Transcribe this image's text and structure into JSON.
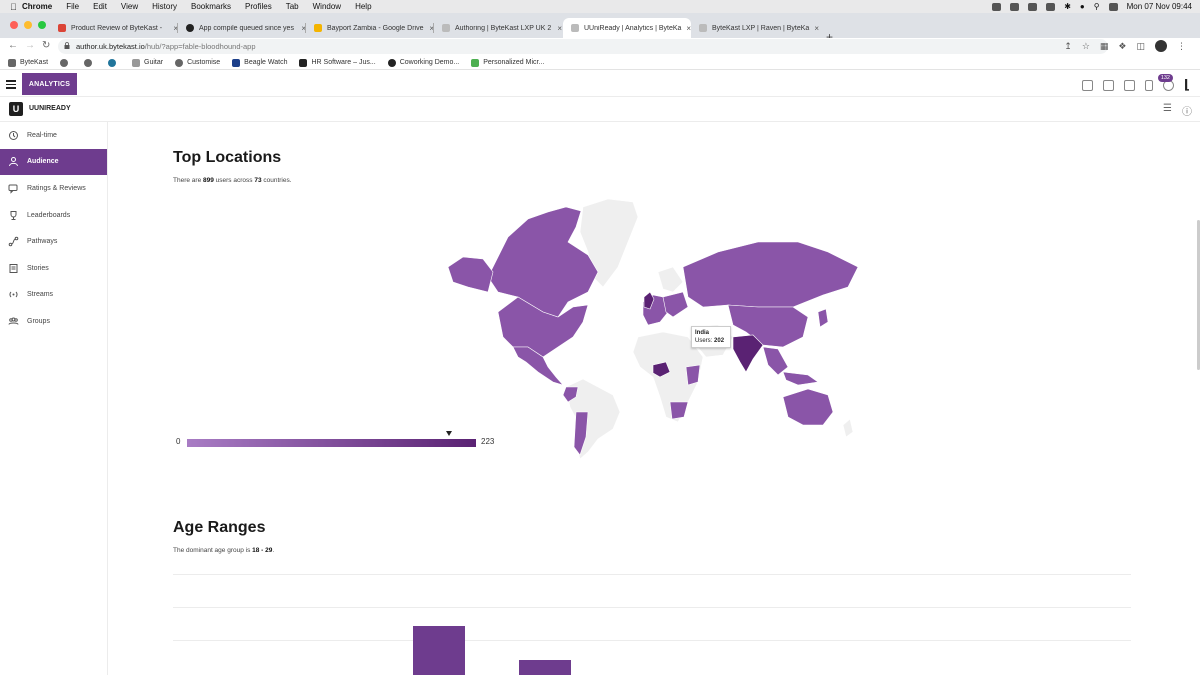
{
  "menubar": {
    "app": "Chrome",
    "items": [
      "File",
      "Edit",
      "View",
      "History",
      "Bookmarks",
      "Profiles",
      "Tab",
      "Window",
      "Help"
    ],
    "clock": "Mon 07 Nov  09:44"
  },
  "tabs": [
    {
      "label": "Product Review of ByteKast - ",
      "color": "#db4437"
    },
    {
      "label": "App compile queued since yes",
      "color": "#222222"
    },
    {
      "label": "Bayport Zambia - Google Drive",
      "color": "#f4b400"
    },
    {
      "label": "Authoring | ByteKast LXP UK 2",
      "color": "#999999"
    },
    {
      "label": "UUniReady | Analytics | ByteKa",
      "color": "#999999"
    },
    {
      "label": "ByteKast LXP | Raven | ByteKa",
      "color": "#999999"
    }
  ],
  "address": {
    "host": "author.uk.bytekast.io",
    "path": "/hub/?app=fable-bloodhound-app"
  },
  "bookmarks": [
    "ByteKast",
    "",
    "",
    "",
    "Guitar",
    "Customise",
    "Beagle Watch",
    "HR Software – Jus...",
    "Coworking Demo...",
    "Personalized Micr..."
  ],
  "header": {
    "section": "ANALYTICS",
    "badge": "132"
  },
  "org": {
    "name": "UUNIREADY",
    "logo": "U"
  },
  "sidebar": {
    "items": [
      {
        "label": "Real-time",
        "icon": "realtime-icon"
      },
      {
        "label": "Audience",
        "icon": "user-icon"
      },
      {
        "label": "Ratings & Reviews",
        "icon": "chat-icon"
      },
      {
        "label": "Leaderboards",
        "icon": "trophy-icon"
      },
      {
        "label": "Pathways",
        "icon": "pathway-icon"
      },
      {
        "label": "Stories",
        "icon": "book-icon"
      },
      {
        "label": "Streams",
        "icon": "broadcast-icon"
      },
      {
        "label": "Groups",
        "icon": "groups-icon"
      }
    ],
    "active": "Audience"
  },
  "locations": {
    "title": "Top Locations",
    "desc_pre": "There are ",
    "users": "899",
    "desc_mid": " users across ",
    "countries": "73",
    "desc_post": " countries.",
    "legend_min": "0",
    "legend_max": "223",
    "legend_marker": 202,
    "tooltip_country": "India",
    "tooltip_label": "Users: ",
    "tooltip_value": "202",
    "colors": {
      "light": "#a87cc4",
      "mid": "#8a55a8",
      "dark": "#5a2273",
      "none": "#efefef"
    }
  },
  "age": {
    "title": "Age Ranges",
    "desc_pre": "The dominant age group is ",
    "dominant": "18 - 29",
    "desc_post": ".",
    "bar_color": "#6e3c8e"
  }
}
